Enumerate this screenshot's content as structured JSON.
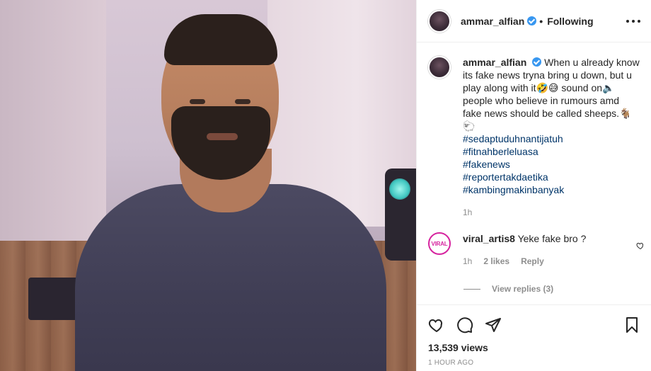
{
  "post_author": {
    "username": "ammar_alfian",
    "separator": "•",
    "follow_label": "Following",
    "verified_icon": "verified-badge-icon"
  },
  "caption": {
    "username": "ammar_alfian",
    "text": "When u already know its fake news tryna bring u down, but u play along with it🤣😅 sound on🔈 people who believe in rumours amd fake news should be called sheeps.🐐🐑",
    "hashtags": [
      "#sedaptuduhnantijatuh",
      "#fitnahberleluasa",
      "#fakenews",
      "#reportertakdaetika",
      "#kambingmakinbanyak"
    ],
    "time": "1h"
  },
  "comment": {
    "avatar_text": "VIRAL",
    "username": "viral_artis8",
    "text": "Yeke fake bro ?",
    "time": "1h",
    "likes": "2 likes",
    "reply_label": "Reply",
    "view_replies": "View replies (3)"
  },
  "actions": {
    "icons": [
      "heart-icon",
      "comment-icon",
      "share-icon",
      "bookmark-icon"
    ]
  },
  "stats": {
    "views": "13,539 views",
    "posted": "1 HOUR AGO"
  },
  "colors": {
    "verified": "#3897f0",
    "hashtag": "#003569",
    "muted": "#8e8e8e",
    "viral_accent": "#d6249f"
  }
}
